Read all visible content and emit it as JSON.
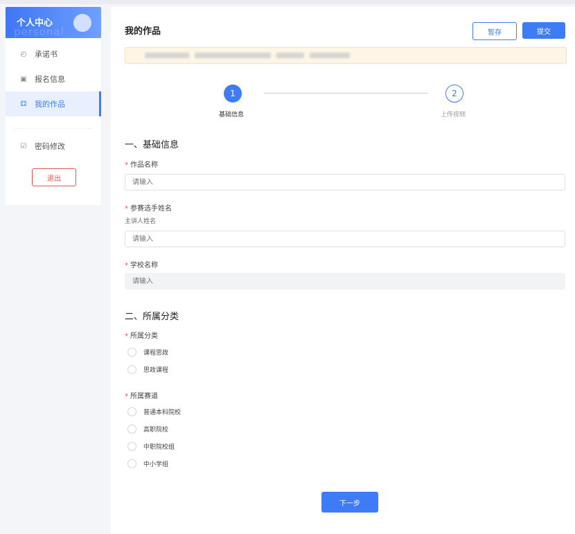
{
  "sidebar": {
    "title": "个人中心",
    "ghost_text": "personal",
    "items": [
      {
        "label": "承诺书",
        "icon": "commitment-icon"
      },
      {
        "label": "报名信息",
        "icon": "registration-icon"
      },
      {
        "label": "我的作品",
        "icon": "works-icon"
      },
      {
        "label": "密码修改",
        "icon": "password-icon"
      }
    ],
    "logout_label": "退出"
  },
  "main": {
    "title": "我的作品",
    "save_label": "暂存",
    "submit_label": "提交"
  },
  "steps": [
    {
      "number": "1",
      "label": "基础信息"
    },
    {
      "number": "2",
      "label": "上传视频"
    }
  ],
  "form": {
    "section1_title": "一、基础信息",
    "work_name_label": "作品名称",
    "work_name_placeholder": "请输入",
    "contestant_label": "参赛选手姓名",
    "contestant_sublabel": "主讲人姓名",
    "contestant_placeholder": "请输入",
    "school_label": "学校名称",
    "school_placeholder": "请输入",
    "section2_title": "二、所属分类",
    "category_label": "所属分类",
    "category_options": [
      "课程思政",
      "思政课程"
    ],
    "track_label": "所属赛道",
    "track_options": [
      "普通本科院校",
      "高职院校",
      "中职院校组",
      "中小学组"
    ]
  },
  "next_label": "下一步",
  "colors": {
    "accent": "#3e7bf6",
    "danger": "#e05656",
    "notice_bg": "#fdf6e6"
  }
}
